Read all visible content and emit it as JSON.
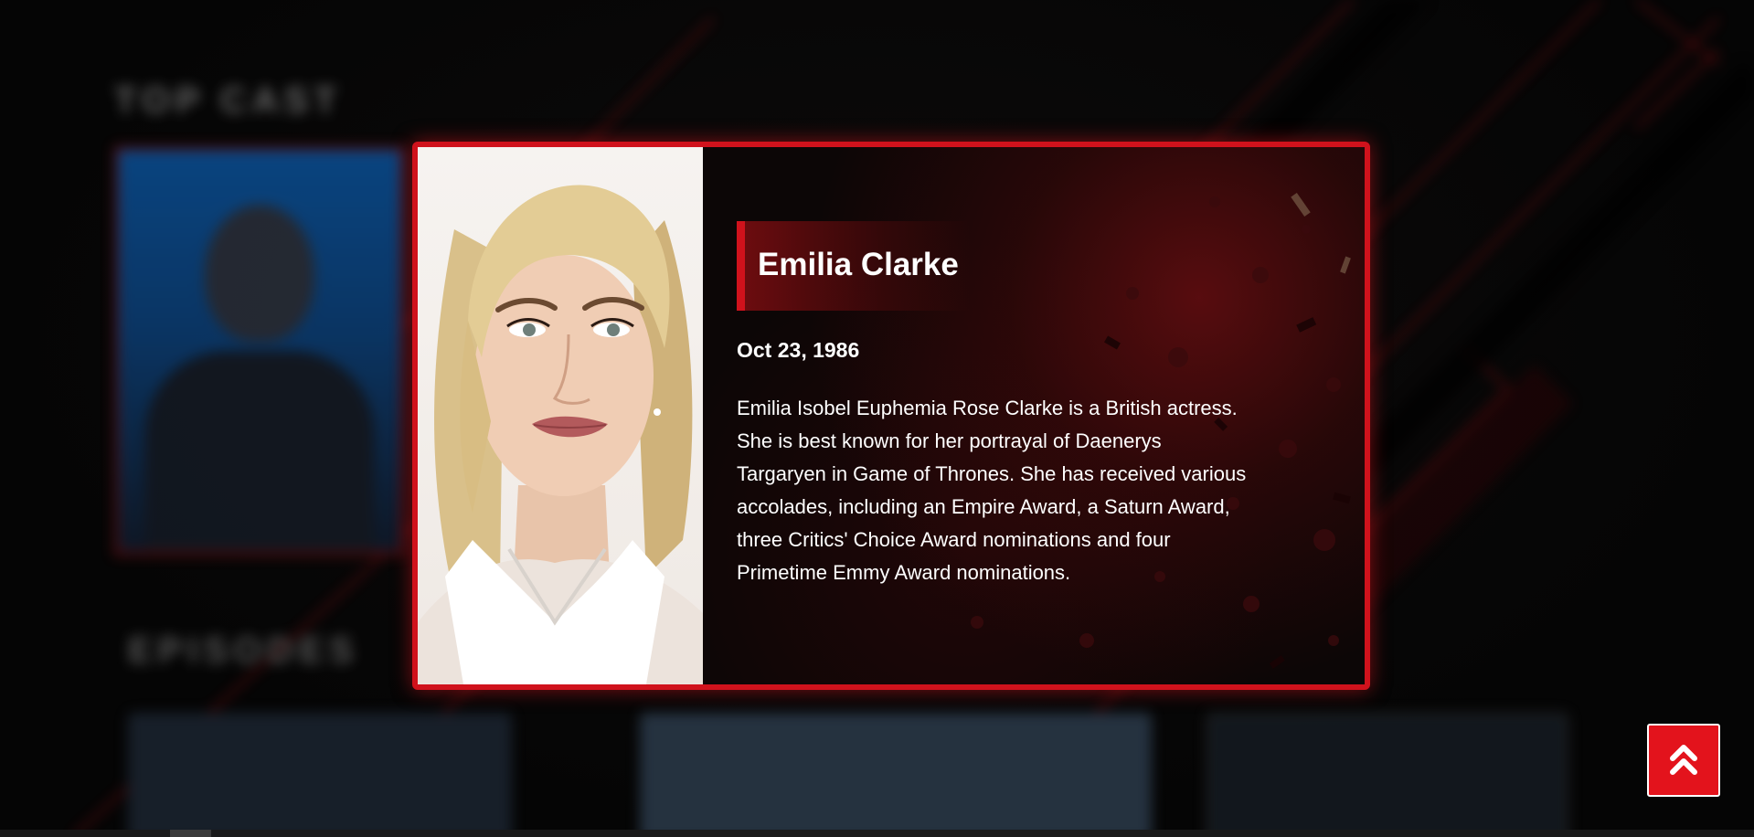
{
  "background": {
    "section_title": "TOP CAST",
    "section_title_2": "EPISODES"
  },
  "actor": {
    "name": "Emilia Clarke",
    "birth_date": "Oct 23, 1986",
    "bio": "Emilia Isobel Euphemia Rose Clarke is a British actress. She is best known for her portrayal of Daenerys Targaryen in Game of Thrones. She has received various accolades, including an Empire Award, a Saturn Award, three Critics' Choice Award nominations and four Primetime Emmy Award nominations."
  },
  "icons": {
    "back_to_top": "double-chevron-up-icon",
    "indicator": "radio-dot-icon"
  },
  "colors": {
    "accent": "#d0121c",
    "button": "#e3131c",
    "text": "#ffffff",
    "background": "#050505"
  }
}
